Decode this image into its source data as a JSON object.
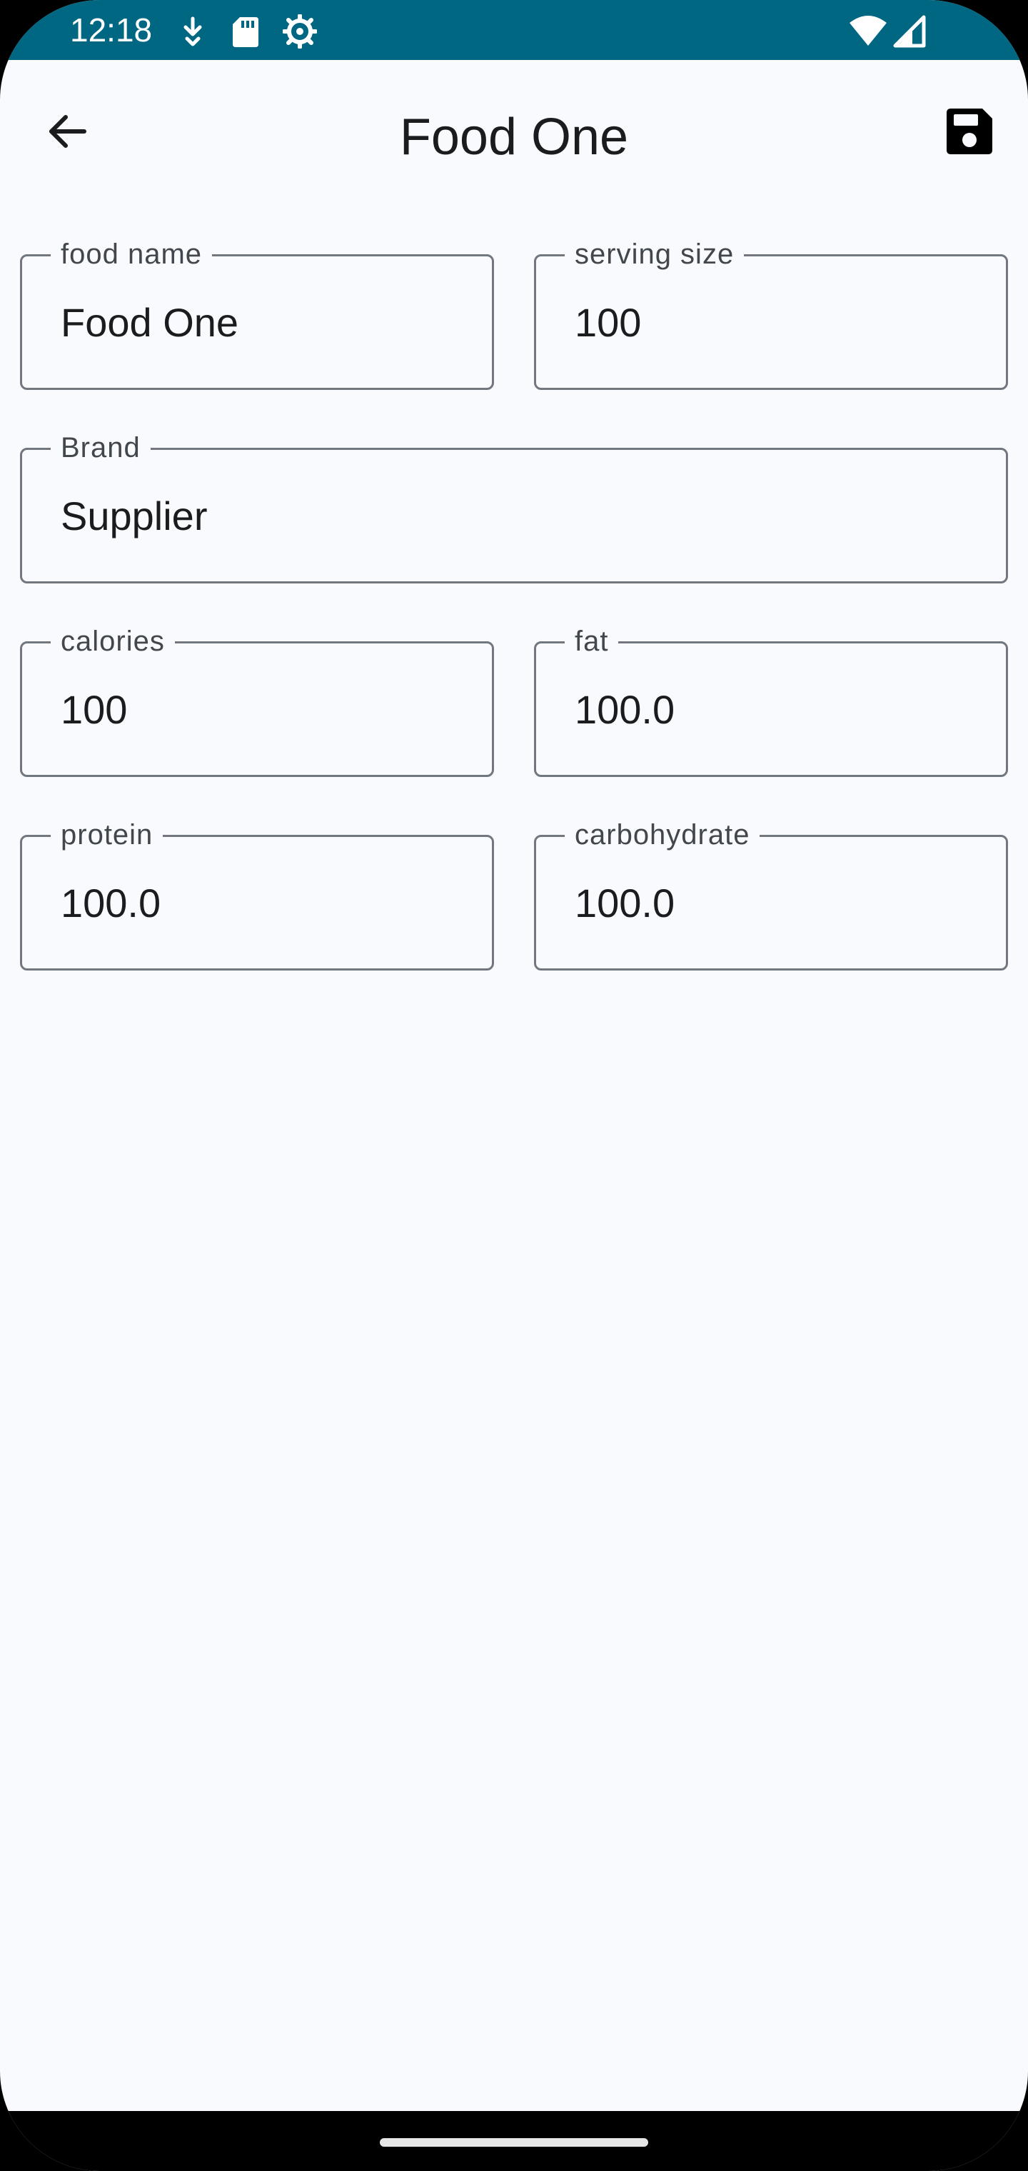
{
  "status_bar": {
    "time": "12:18",
    "icons": [
      "download-icon",
      "sd-card-icon",
      "settings-gear-icon",
      "wifi-icon",
      "signal-icon"
    ],
    "color": "#006783"
  },
  "app_bar": {
    "title": "Food One",
    "back_icon": "arrow-back-icon",
    "save_icon": "save-floppy-icon"
  },
  "form": {
    "food_name": {
      "label": "food name",
      "value": "Food One"
    },
    "serving_size": {
      "label": "serving size",
      "value": "100"
    },
    "brand": {
      "label": "Brand",
      "value": "Supplier"
    },
    "calories": {
      "label": "calories",
      "value": "100"
    },
    "fat": {
      "label": "fat",
      "value": "100.0"
    },
    "protein": {
      "label": "protein",
      "value": "100.0"
    },
    "carbohydrate": {
      "label": "carbohydrate",
      "value": "100.0"
    }
  },
  "colors": {
    "background": "#f9fafd",
    "outline": "#72777f",
    "text": "#1a1c1e"
  }
}
